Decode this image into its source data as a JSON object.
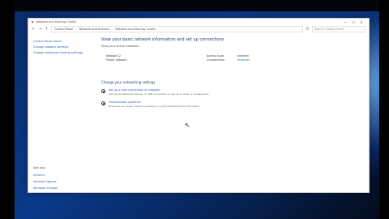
{
  "window": {
    "title": "Network and Sharing Center",
    "controls": [
      "—",
      "☐",
      "✕"
    ]
  },
  "address": {
    "nav": [
      "←",
      "→",
      "↑",
      "⟳"
    ],
    "crumbs": [
      "Control Panel",
      "Network and Internet",
      "Network and Sharing Center"
    ],
    "search_placeholder": "Search Control Panel"
  },
  "sidebar": {
    "items": [
      "Control Panel Home",
      "Change adapter settings",
      "Change advanced sharing settings"
    ],
    "see_also_title": "See also",
    "see_also": [
      "Infrared",
      "Internet Options",
      "Windows Firewall"
    ]
  },
  "main": {
    "heading": "View your basic network information and set up connections",
    "active_label": "View your active networks",
    "network_name": "Network 2",
    "network_type": "Public network",
    "access_label": "Access type:",
    "access_value": "Internet",
    "connections_label": "Connections:",
    "connections_value": "Ethernet",
    "change_heading": "Change your networking settings",
    "options": [
      {
        "label": "Set up a new connection or network",
        "desc": "Set up a broadband, dial-up, or VPN connection; or set up a router or access point.",
        "selected": true
      },
      {
        "label": "Troubleshoot problems",
        "desc": "Diagnose and repair network problems, or get troubleshooting information.",
        "selected": false
      }
    ]
  }
}
